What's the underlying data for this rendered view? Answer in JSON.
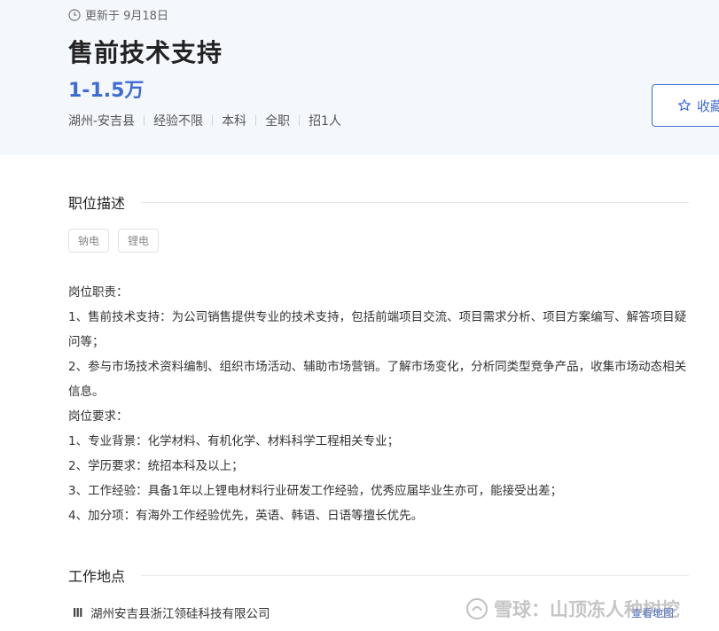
{
  "header": {
    "updated": "更新于 9月18日",
    "job_title": "售前技术支持",
    "salary": "1-1.5万",
    "meta": [
      "湖州-安吉县",
      "经验不限",
      "本科",
      "全职",
      "招1人"
    ],
    "favorite_label": "收藏"
  },
  "description": {
    "section_title": "职位描述",
    "tags": [
      "钠电",
      "锂电"
    ],
    "lines": [
      "岗位职责：",
      "1、售前技术支持：为公司销售提供专业的技术支持，包括前端项目交流、项目需求分析、项目方案编写、解答项目疑问等；",
      "2、参与市场技术资料编制、组织市场活动、辅助市场营销。了解市场变化，分析同类型竞争产品，收集市场动态相关信息。",
      "岗位要求：",
      "1、专业背景：化学材料、有机化学、材料科学工程相关专业；",
      "2、学历要求：统招本科及以上；",
      "3、工作经验：具备1年以上锂电材料行业研发工作经验，优秀应届毕业生亦可，能接受出差；",
      "4、加分项：有海外工作经验优先，英语、韩语、日语等擅长优先。"
    ]
  },
  "location": {
    "section_title": "工作地点",
    "address": "湖州安吉县浙江领硅科技有限公司",
    "map_link": "查看地图"
  },
  "watermark": "雪球：山顶冻人种树挖",
  "colors": {
    "accent": "#3d6bd6",
    "header_bg": "#f4f7fc"
  }
}
